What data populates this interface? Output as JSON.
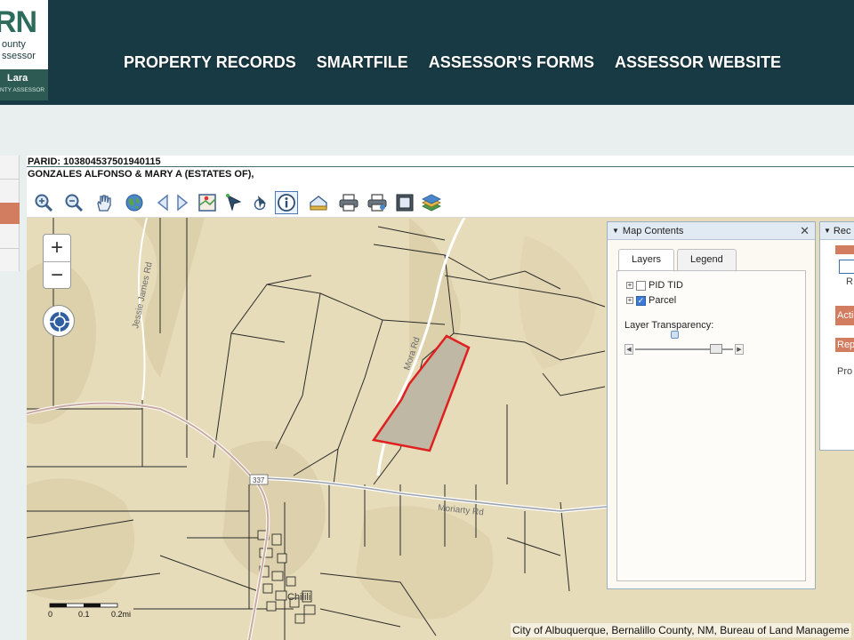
{
  "logo": {
    "letters": "RN",
    "county": "ounty",
    "assessor": "ssessor",
    "name": "Lara",
    "subtitle": "NTY ASSESSOR"
  },
  "nav": {
    "items": [
      "PROPERTY RECORDS",
      "SMARTFILE",
      "ASSESSOR'S FORMS",
      "ASSESSOR WEBSITE"
    ]
  },
  "parcel": {
    "parid": "PARID: 103804537501940115",
    "owner": "GONZALES ALFONSO & MARY A (ESTATES OF),"
  },
  "map": {
    "zoom_in": "+",
    "zoom_out": "−",
    "roads": {
      "jessie_james": "Jessie James Rd",
      "mora": "Mora Rd",
      "moriarty": "Moriarty Rd",
      "route": "337",
      "town": "Chilili"
    },
    "scale": {
      "ticks": [
        "0",
        "0.1",
        "0.2mi"
      ]
    },
    "attribution": "City of Albuquerque, Bernalillo County, NM, Bureau of Land Manageme",
    "colors": {
      "parcel_outline": "#e02020",
      "parcel_fill": "#bfb8a4",
      "base": "#e7dcb9"
    }
  },
  "map_contents": {
    "title": "Map Contents",
    "close": "✕",
    "tabs": [
      "Layers",
      "Legend"
    ],
    "layers": [
      {
        "name": "PID TID",
        "checked": false
      },
      {
        "name": "Parcel",
        "checked": true
      }
    ],
    "transparency_label": "Layer Transparency:",
    "transparency_level": 0.87
  },
  "right_panel": {
    "title": "Rec",
    "action": "Actio",
    "report": "Rep",
    "r_text": "R",
    "pro_text": "Pro"
  }
}
